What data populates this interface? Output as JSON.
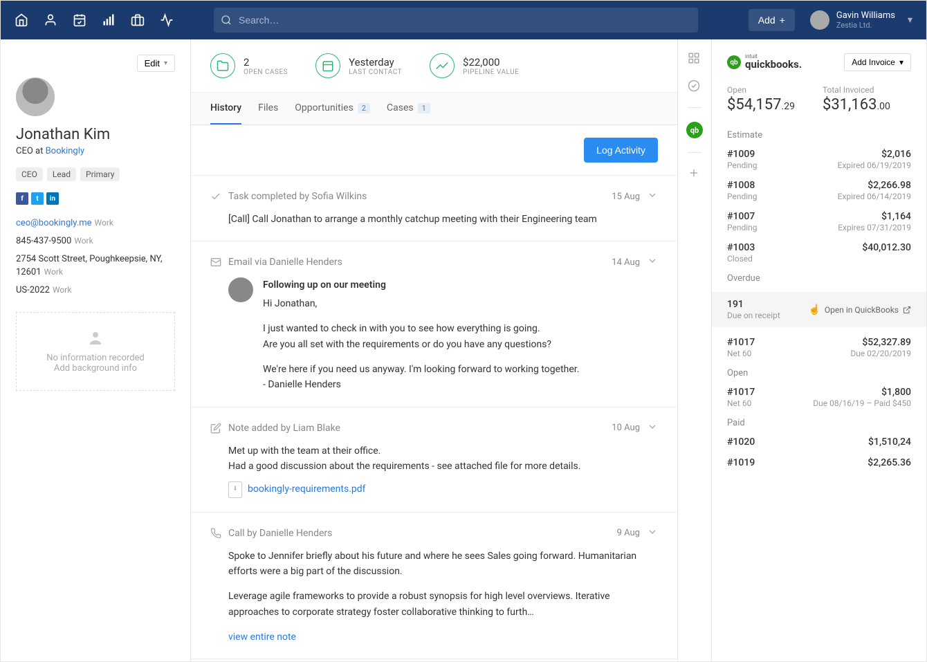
{
  "topnav": {
    "search_placeholder": "Search…",
    "add_label": "Add",
    "user_name": "Gavin Williams",
    "user_org": "Zestia Ltd."
  },
  "profile": {
    "edit_label": "Edit",
    "name": "Jonathan Kim",
    "role": "CEO at ",
    "company": "Bookingly",
    "tags": [
      "CEO",
      "Lead",
      "Primary"
    ],
    "email": "ceo@bookingly.me",
    "email_label": "Work",
    "phone": "845-437-9500",
    "phone_label": "Work",
    "address": "2754 Scott Street, Poughkeepsie, NY, 12601",
    "address_label": "Work",
    "region": "US-2022",
    "region_label": "Work",
    "no_info_line1": "No information recorded",
    "no_info_line2": "Add background info"
  },
  "stats": {
    "open_cases_val": "2",
    "open_cases_label": "OPEN CASES",
    "last_contact_val": "Yesterday",
    "last_contact_label": "LAST CONTACT",
    "pipeline_val": "$22,000",
    "pipeline_label": "PIPELINE VALUE"
  },
  "tabs": {
    "history": "History",
    "files": "Files",
    "opportunities": "Opportunities",
    "opportunities_count": "2",
    "cases": "Cases",
    "cases_count": "1"
  },
  "log_activity_label": "Log Activity",
  "feed": {
    "item1": {
      "title": "Task completed by Sofia Wilkins",
      "date": "15 Aug",
      "body": "[Call] Call Jonathan to arrange a monthly catchup meeting with their Engineering team"
    },
    "item2": {
      "title": "Email via Danielle Henders",
      "date": "14 Aug",
      "subject": "Following up on our meeting",
      "greeting": "Hi Jonathan,",
      "p1": "I just wanted to check in with you to see how everything is going.",
      "p2": "Are you all set with the requirements or do you have any questions?",
      "p3": "We're here if you need us anyway. I'm looking forward to working together.",
      "signoff": "- Danielle Henders"
    },
    "item3": {
      "title": "Note added by Liam Blake",
      "date": "10 Aug",
      "line1": "Met up with the team at their office.",
      "line2": "Had a good discussion about the requirements - see attached file for more details.",
      "file": "bookingly-requirements.pdf"
    },
    "item4": {
      "title": "Call by Danielle Henders",
      "date": "9 Aug",
      "p1": "Spoke to Jennifer briefly about his future and where he sees Sales going forward. Humanitarian efforts were a big part of the discussion.",
      "p2": "Leverage agile frameworks to provide a robust synopsis for high level overviews. Iterative approaches to corporate strategy foster collaborative thinking to furth…",
      "view_link": "view entire note"
    }
  },
  "qb": {
    "intuit": "intuit",
    "brand": "quickbooks.",
    "add_invoice": "Add Invoice",
    "open_label": "Open",
    "open_val": "$54,157",
    "open_cents": ".29",
    "total_label": "Total Invoiced",
    "total_val": "$31,163",
    "total_cents": ".00",
    "section_estimate": "Estimate",
    "section_overdue": "Overdue",
    "section_open": "Open",
    "section_paid": "Paid",
    "open_in_qb": "Open in QuickBooks",
    "estimates": [
      {
        "id": "#1009",
        "status": "Pending",
        "amt": "$2,016",
        "sub": "Expired 06/19/2019"
      },
      {
        "id": "#1008",
        "status": "Pending",
        "amt": "$2,266.98",
        "sub": "Expired 06/14/2019"
      },
      {
        "id": "#1007",
        "status": "Pending",
        "amt": "$1,164",
        "sub": "Expires 07/31/2019"
      },
      {
        "id": "#1003",
        "status": "Closed",
        "amt": "$40,012.30",
        "sub": ""
      }
    ],
    "overdue": [
      {
        "id": "191",
        "status": "Due on receipt",
        "amt": "",
        "sub": ""
      },
      {
        "id": "#1017",
        "status": "Net 60",
        "amt": "$52,327.89",
        "sub": "Due 02/20/2019"
      }
    ],
    "open_items": [
      {
        "id": "#1017",
        "status": "Net 60",
        "amt": "$1,800",
        "sub": "Due 08/16/19 – Paid $450"
      }
    ],
    "paid": [
      {
        "id": "#1020",
        "status": "",
        "amt": "$1,510,24",
        "sub": ""
      },
      {
        "id": "#1019",
        "status": "",
        "amt": "$2,265.36",
        "sub": ""
      }
    ]
  }
}
